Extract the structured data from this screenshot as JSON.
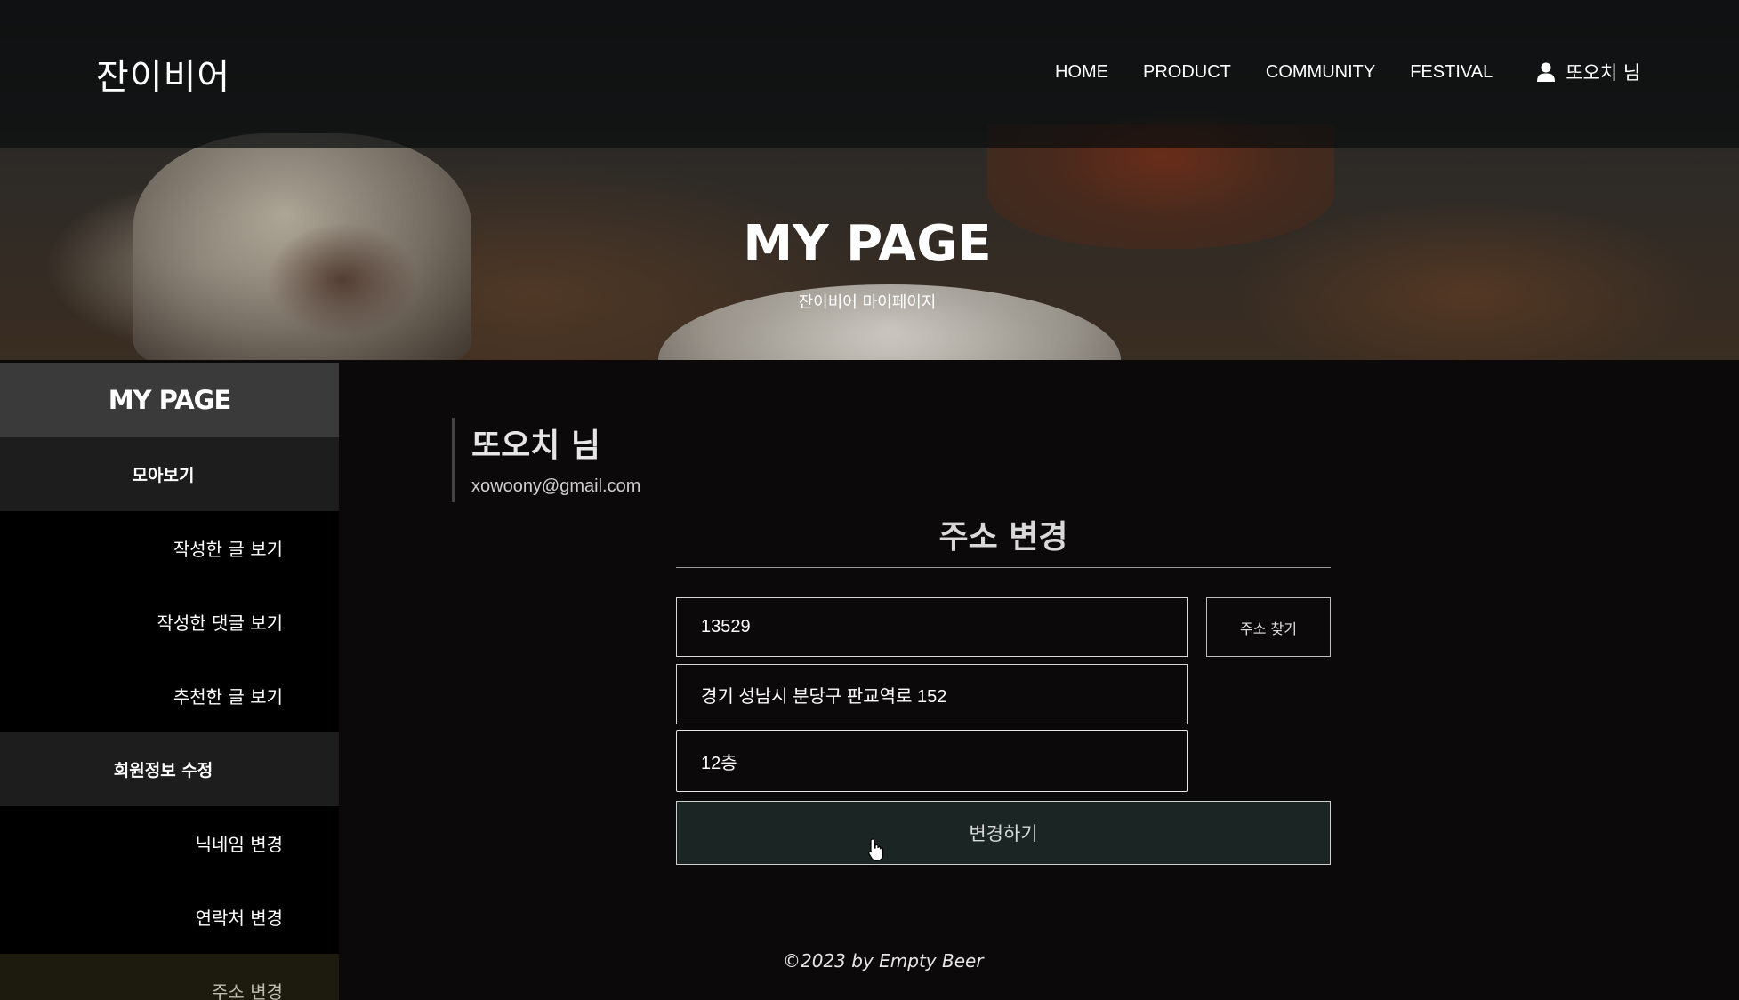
{
  "header": {
    "logo": "잔이비어",
    "nav": [
      "HOME",
      "PRODUCT",
      "COMMUNITY",
      "FESTIVAL"
    ],
    "user_label": "또오치 님",
    "user_icon": "user-icon"
  },
  "hero": {
    "title": "MY PAGE",
    "subtitle": "잔이비어 마이페이지"
  },
  "sidebar": {
    "title": "MY PAGE",
    "sections": [
      {
        "label": "모아보기",
        "items": [
          "작성한 글 보기",
          "작성한 댓글 보기",
          "추천한 글 보기"
        ]
      },
      {
        "label": "회원정보 수정",
        "items": [
          "닉네임 변경",
          "연락처 변경",
          "주소 변경"
        ]
      }
    ],
    "active_item": "주소 변경"
  },
  "profile": {
    "name": "또오치 님",
    "email": "xowoony@gmail.com"
  },
  "address_form": {
    "title": "주소 변경",
    "zipcode": "13529",
    "find_button": "주소 찾기",
    "address_primary": "경기 성남시 분당구 판교역로 152",
    "address_secondary": "12층",
    "submit_button": "변경하기"
  },
  "footer": {
    "copyright": "©2023 by Empty Beer"
  }
}
